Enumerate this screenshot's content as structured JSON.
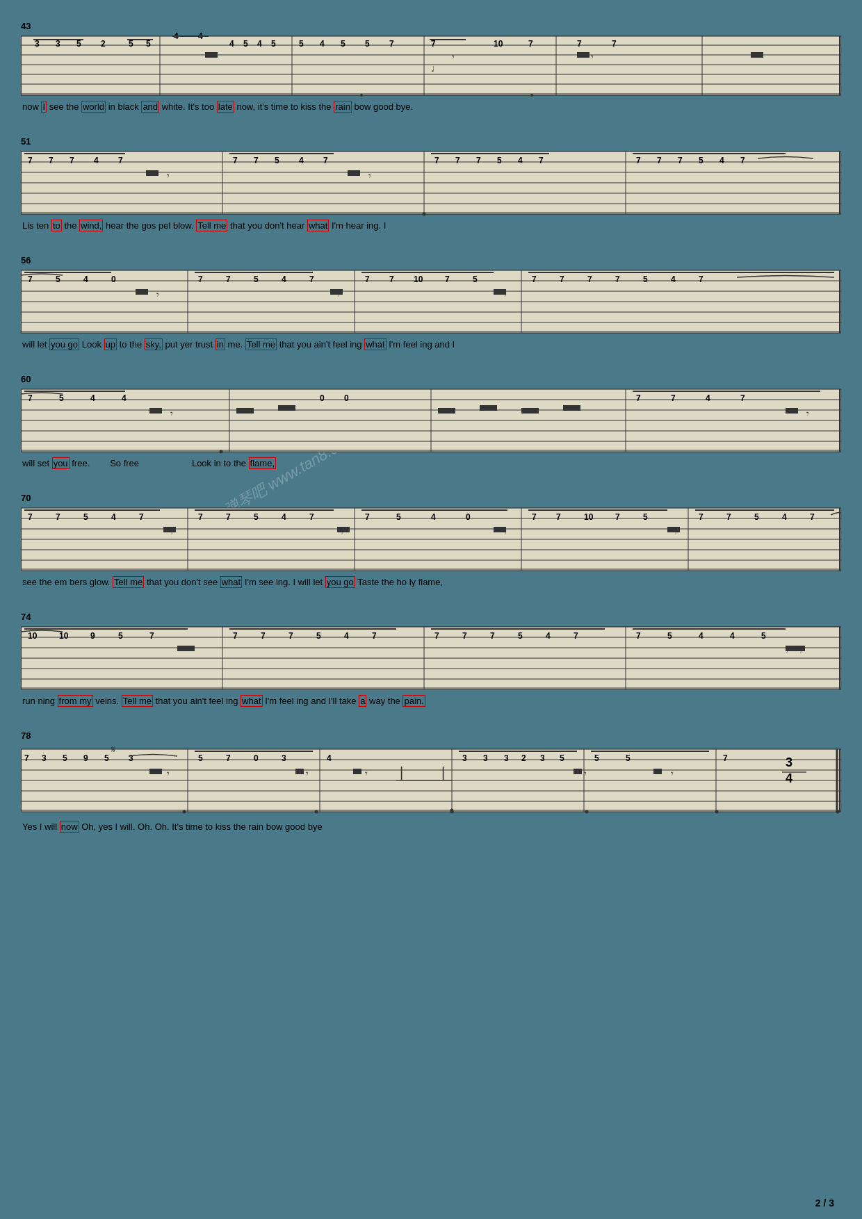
{
  "page": {
    "number": "2 / 3",
    "watermark": "弹琴吧 www.tan8.com",
    "background": "#4a7a8a"
  },
  "sections": [
    {
      "id": "section-43",
      "measure_start": 43,
      "lyrics": "now I  see the  world  in black  and  white.  It's  too late now,  it's  time  to kiss  the rain  bow  good  bye."
    },
    {
      "id": "section-51",
      "measure_start": 51,
      "lyrics": "Lis ten to  the wind,  hear the gos pel blow.  Tell me  that you  don't hear  what  I'm  hear ing. I"
    },
    {
      "id": "section-56",
      "measure_start": 56,
      "lyrics": "will let you go  Look up to the sky,  put yer trust in me.  Tell me  that you  ain't feel  ing what  I'm feel ing and I"
    },
    {
      "id": "section-60",
      "measure_start": 60,
      "lyrics": "will set you free.  So  free  Look in  to the flame,"
    },
    {
      "id": "section-70",
      "measure_start": 70,
      "lyrics": "see the em bers glow.  Tell me  that you  don't see  what  I'm  see ing. I  will let you go  Taste the ho ly flame,"
    },
    {
      "id": "section-74",
      "measure_start": 74,
      "lyrics": "run ning from my veins.  Tell me  that you  ain't  feel  ing what  I'm feel ing and I'll  take a  way the pain."
    },
    {
      "id": "section-78",
      "measure_start": 78,
      "lyrics": "Yes I  will now  Oh,  yes I will.  Oh.  Oh.  It's  time to kiss  the rain  bow  good  bye"
    }
  ]
}
